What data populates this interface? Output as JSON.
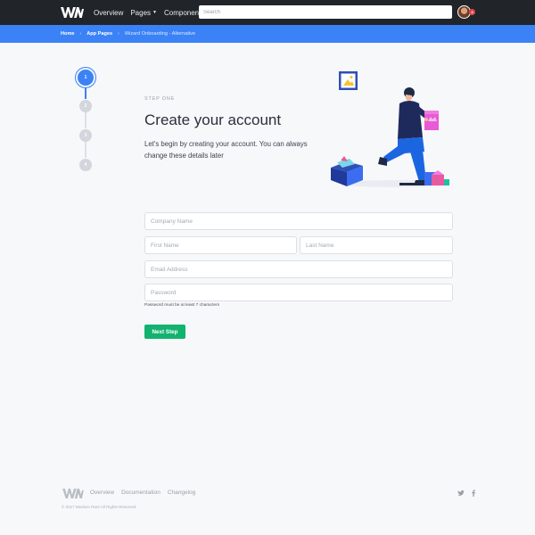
{
  "navbar": {
    "links": [
      {
        "label": "Overview",
        "has_caret": false
      },
      {
        "label": "Pages",
        "has_caret": true
      },
      {
        "label": "Components",
        "has_caret": true
      }
    ],
    "search_placeholder": "Search",
    "notification_count": "4"
  },
  "breadcrumb": {
    "items": [
      "Home",
      "App Pages"
    ],
    "current": "Wizard Onboarding - Alternative"
  },
  "steps": [
    "1",
    "2",
    "3",
    "4"
  ],
  "active_step": 1,
  "heading": {
    "step_label": "STEP ONE",
    "title": "Create your account",
    "lead": "Let's begin by creating your account. You can always change these details later"
  },
  "form": {
    "company_placeholder": "Company Name",
    "first_name_placeholder": "First Name",
    "last_name_placeholder": "Last Name",
    "email_placeholder": "Email Address",
    "password_placeholder": "Password",
    "password_hint": "Password must be at least 7 characters",
    "submit_label": "Next Step"
  },
  "footer": {
    "links": [
      "Overview",
      "Documentation",
      "Changelog"
    ],
    "copyright": "© 2017 Medium Rare All Rights Reserved"
  },
  "icons": {
    "social": [
      "twitter-icon",
      "facebook-icon"
    ],
    "twitter_glyph": "🐦",
    "facebook_glyph": "f"
  },
  "colors": {
    "navbar_bg": "#212529",
    "accent_blue": "#3b82f6",
    "button_green": "#12b26f",
    "page_bg": "#f7f8fa"
  }
}
